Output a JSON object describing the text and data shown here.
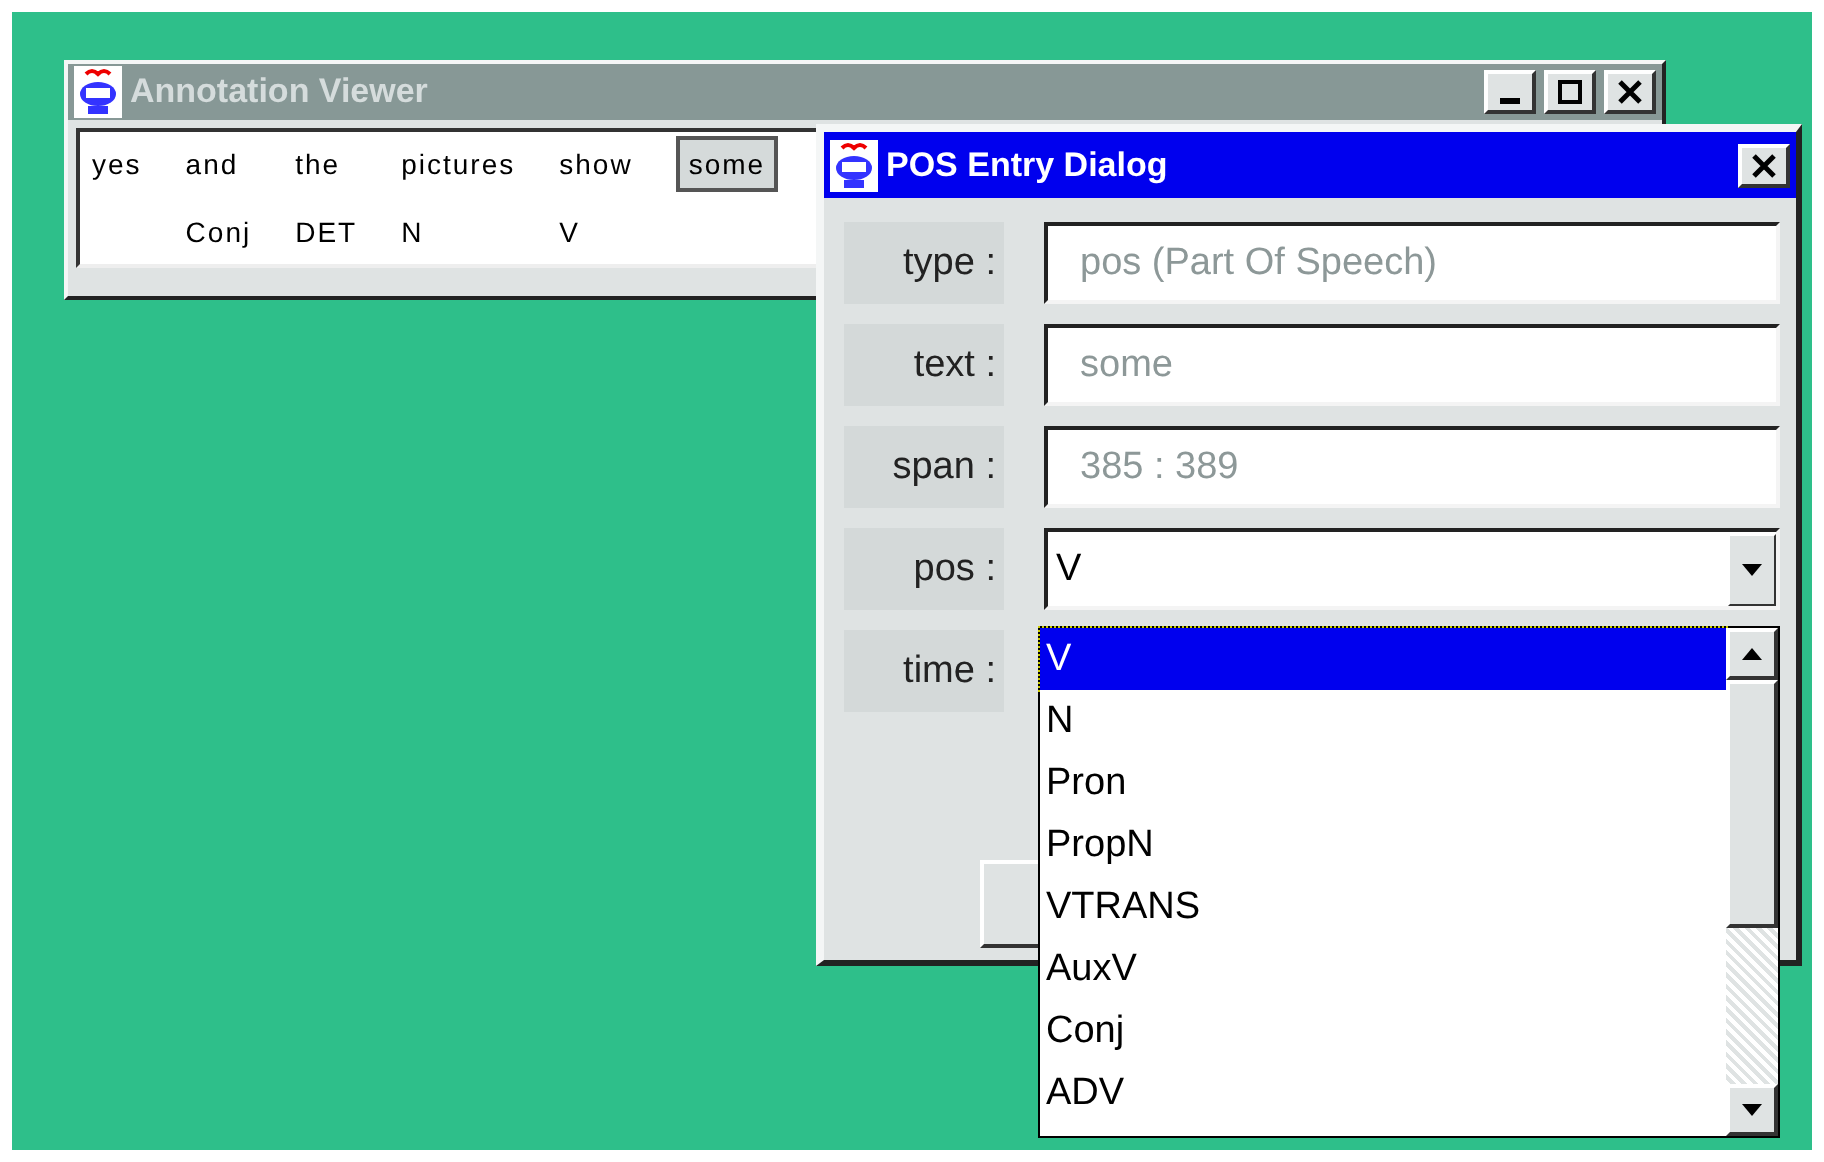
{
  "annotation_viewer": {
    "title": "Annotation Viewer",
    "tokens": [
      {
        "word": "yes",
        "selected": false
      },
      {
        "word": "and",
        "tag": "Conj",
        "selected": false
      },
      {
        "word": "the",
        "tag": "DET",
        "selected": false
      },
      {
        "word": "pictures",
        "tag": "N",
        "selected": false
      },
      {
        "word": "show",
        "tag": "V",
        "selected": false
      },
      {
        "word": "some",
        "selected": true
      }
    ]
  },
  "pos_dialog": {
    "title": "POS Entry Dialog",
    "fields": [
      {
        "label": "type :",
        "kind": "text",
        "value": "pos (Part Of Speech)",
        "disabled": true
      },
      {
        "label": "text :",
        "kind": "text",
        "value": "some",
        "disabled": true
      },
      {
        "label": "span :",
        "kind": "text",
        "value": "385 : 389",
        "disabled": true
      },
      {
        "label": "pos :",
        "kind": "combo",
        "value": "V"
      },
      {
        "label": "time :",
        "kind": "hidden"
      }
    ],
    "dropdown": {
      "options": [
        {
          "label": "V",
          "selected": true
        },
        {
          "label": "N",
          "selected": false
        },
        {
          "label": "Pron",
          "selected": false
        },
        {
          "label": "PropN",
          "selected": false
        },
        {
          "label": "VTRANS",
          "selected": false
        },
        {
          "label": "AuxV",
          "selected": false
        },
        {
          "label": "Conj",
          "selected": false
        },
        {
          "label": "ADV",
          "selected": false
        }
      ]
    }
  }
}
